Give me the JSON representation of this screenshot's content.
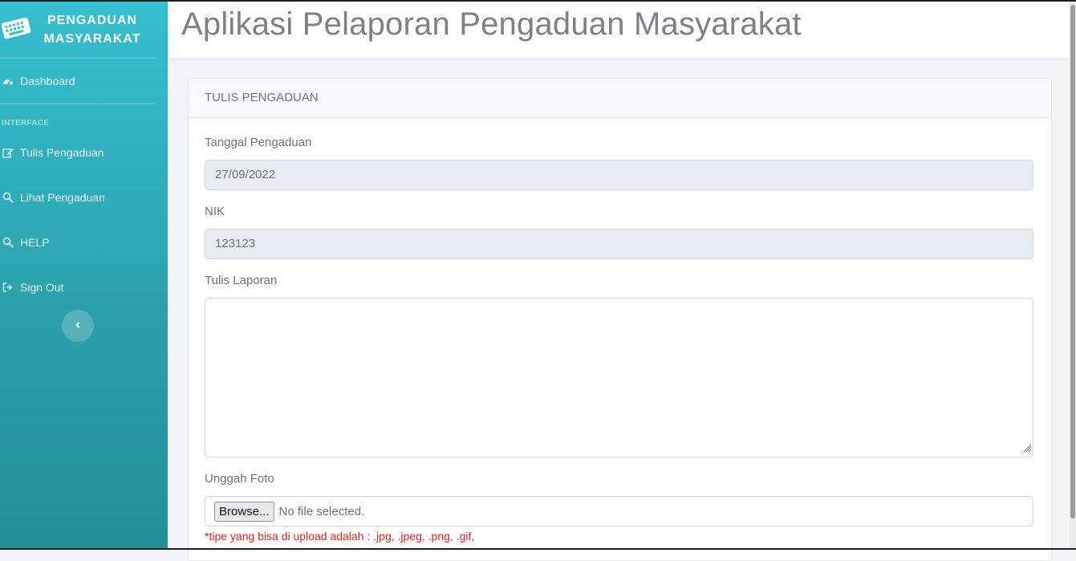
{
  "app": {
    "title": "Aplikasi Pelaporan Pengaduan Masyarakat"
  },
  "brand": {
    "line1": "PENGADUAN",
    "line2": "MASYARAKAT",
    "icon": "keyboard-icon"
  },
  "sidebar": {
    "dashboard": {
      "label": "Dashboard",
      "icon": "dashboard-icon"
    },
    "section_heading": "INTERFACE",
    "items": [
      {
        "label": "Tulis Pengaduan",
        "icon": "edit-icon"
      },
      {
        "label": "Lihat Pengaduan",
        "icon": "search-icon"
      },
      {
        "label": "HELP",
        "icon": "search-icon"
      },
      {
        "label": "Sign Out",
        "icon": "sign-out-icon"
      }
    ],
    "toggle_icon": "chevron-left-icon"
  },
  "form": {
    "card_title": "TULIS PENGADUAN",
    "tanggal": {
      "label": "Tanggal Pengaduan",
      "value": "27/09/2022"
    },
    "nik": {
      "label": "NIK",
      "value": "123123"
    },
    "laporan": {
      "label": "Tulis Laporan",
      "value": ""
    },
    "foto": {
      "label": "Unggah Foto",
      "browse_label": "Browse...",
      "status": "No file selected.",
      "hint": "*tipe yang bisa di upload adalah : .jpg, .jpeg, .png, .gif,"
    }
  },
  "colors": {
    "sidebar_top": "#36bfcf",
    "sidebar_bottom": "#248f99",
    "hint_text": "#e02020",
    "title_text": "#7d8088"
  }
}
